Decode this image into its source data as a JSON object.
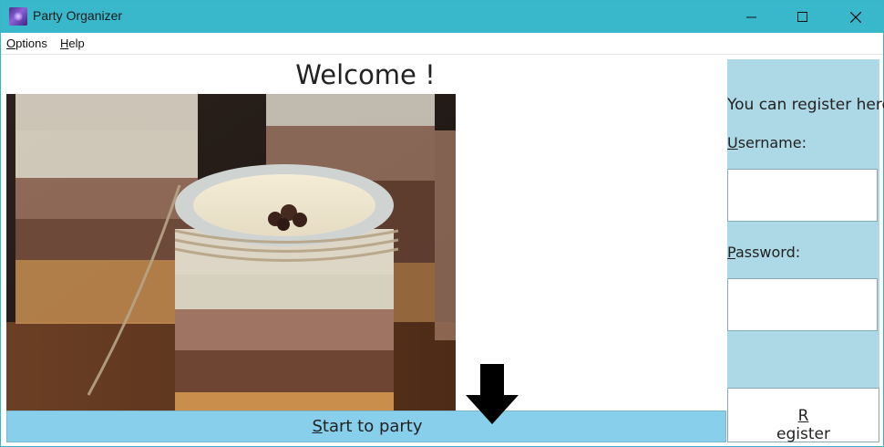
{
  "window": {
    "title": "Party Organizer"
  },
  "menu": {
    "options_first": "O",
    "options_rest": "ptions",
    "help_first": "H",
    "help_rest": "elp"
  },
  "main": {
    "welcome": "Welcome !",
    "start_first": "S",
    "start_rest": "tart to party"
  },
  "register": {
    "heading": "You can register here",
    "username_first": "U",
    "username_rest": "sername:",
    "password_first": "P",
    "password_rest": "assword:",
    "username_value": "",
    "password_value": "",
    "button_first": "R",
    "button_rest": "egister"
  },
  "colors": {
    "titlebar": "#3ab8cb",
    "start_bar": "#87cfea",
    "side_panel": "#add8e6"
  }
}
